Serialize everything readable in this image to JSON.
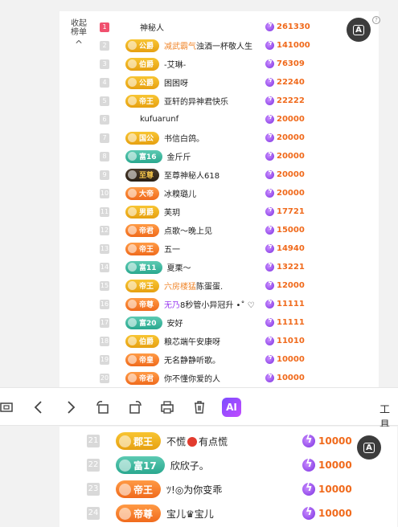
{
  "sidebar": {
    "collapse_label_1": "收起",
    "collapse_label_2": "榜单"
  },
  "top_list": [
    {
      "rank": "1",
      "badge": "",
      "badge_style": "none",
      "name": "神秘人",
      "name_hl": "",
      "score": "261330"
    },
    {
      "rank": "2",
      "badge": "公爵",
      "badge_style": "gold",
      "name": "浊酒一杯敬人生",
      "name_hl": "减武霸气",
      "score": "141000"
    },
    {
      "rank": "3",
      "badge": "伯爵",
      "badge_style": "gold",
      "name": "-艾琳-",
      "name_hl": "",
      "score": "76309"
    },
    {
      "rank": "4",
      "badge": "公爵",
      "badge_style": "gold",
      "name": "困困呀",
      "name_hl": "",
      "score": "22240"
    },
    {
      "rank": "5",
      "badge": "帝王",
      "badge_style": "gold",
      "name": "亚轩的异神君快乐",
      "name_hl": "",
      "score": "22222"
    },
    {
      "rank": "6",
      "badge": "",
      "badge_style": "none",
      "name": "kufuarunf",
      "name_hl": "",
      "score": "20000"
    },
    {
      "rank": "7",
      "badge": "国公",
      "badge_style": "gold",
      "name": "书信白鸽。",
      "name_hl": "",
      "score": "20000"
    },
    {
      "rank": "8",
      "badge": "富16",
      "badge_style": "teal",
      "name": "金斤斤",
      "name_hl": "",
      "score": "20000"
    },
    {
      "rank": "9",
      "badge": "至尊",
      "badge_style": "dark",
      "name": "至尊神秘人618",
      "name_hl": "",
      "score": "20000"
    },
    {
      "rank": "10",
      "badge": "大帝",
      "badge_style": "orange",
      "name": "冰糗璐儿",
      "name_hl": "",
      "score": "20000"
    },
    {
      "rank": "11",
      "badge": "男爵",
      "badge_style": "gold",
      "name": "芙玥",
      "name_hl": "",
      "score": "17721"
    },
    {
      "rank": "12",
      "badge": "帝君",
      "badge_style": "orange",
      "name": "点歌～晚上见",
      "name_hl": "",
      "score": "15000"
    },
    {
      "rank": "13",
      "badge": "帝王",
      "badge_style": "orange",
      "name": "五一",
      "name_hl": "",
      "score": "14940"
    },
    {
      "rank": "14",
      "badge": "富11",
      "badge_style": "teal",
      "name": "夏栗～",
      "name_hl": "",
      "score": "13221"
    },
    {
      "rank": "15",
      "badge": "帝王",
      "badge_style": "gold",
      "name": "陈蛋蛋.",
      "name_hl": "六房楼猛",
      "score": "12000"
    },
    {
      "rank": "16",
      "badge": "帝尊",
      "badge_style": "orange",
      "name": "8秒管小异冠升 •˚ ♡",
      "name_hl": "",
      "name_hl2": "无乃",
      "score": "11111"
    },
    {
      "rank": "17",
      "badge": "富20",
      "badge_style": "teal",
      "name": "安好",
      "name_hl": "",
      "score": "11111"
    },
    {
      "rank": "18",
      "badge": "伯爵",
      "badge_style": "gold",
      "name": "粮芯端午安康呀",
      "name_hl": "",
      "score": "11010"
    },
    {
      "rank": "19",
      "badge": "帝皇",
      "badge_style": "orange",
      "name": "无名静静听歌。",
      "name_hl": "",
      "score": "10000"
    },
    {
      "rank": "20",
      "badge": "帝君",
      "badge_style": "orange",
      "name": "你不懂你爱的人",
      "name_hl": "",
      "score": "10000"
    }
  ],
  "bottom_list": [
    {
      "rank": "21",
      "badge": "郡王",
      "badge_style": "gold",
      "name_a": "不慌",
      "name_b": "有点慌",
      "score": "10000"
    },
    {
      "rank": "22",
      "badge": "富17",
      "badge_style": "teal",
      "name_a": "欣欣子。",
      "name_b": "",
      "score": "10000"
    },
    {
      "rank": "23",
      "badge": "帝王",
      "badge_style": "orange",
      "name_a": "ﾂ!◎为你变乖",
      "name_b": "",
      "score": "10000"
    },
    {
      "rank": "24",
      "badge": "帝尊",
      "badge_style": "orange",
      "name_a": "宝儿♛宝儿",
      "name_b": "",
      "score": "10000"
    }
  ],
  "toolbar": {
    "ai_label": "AI",
    "tools_label": "工具"
  },
  "ocr_label": "A"
}
